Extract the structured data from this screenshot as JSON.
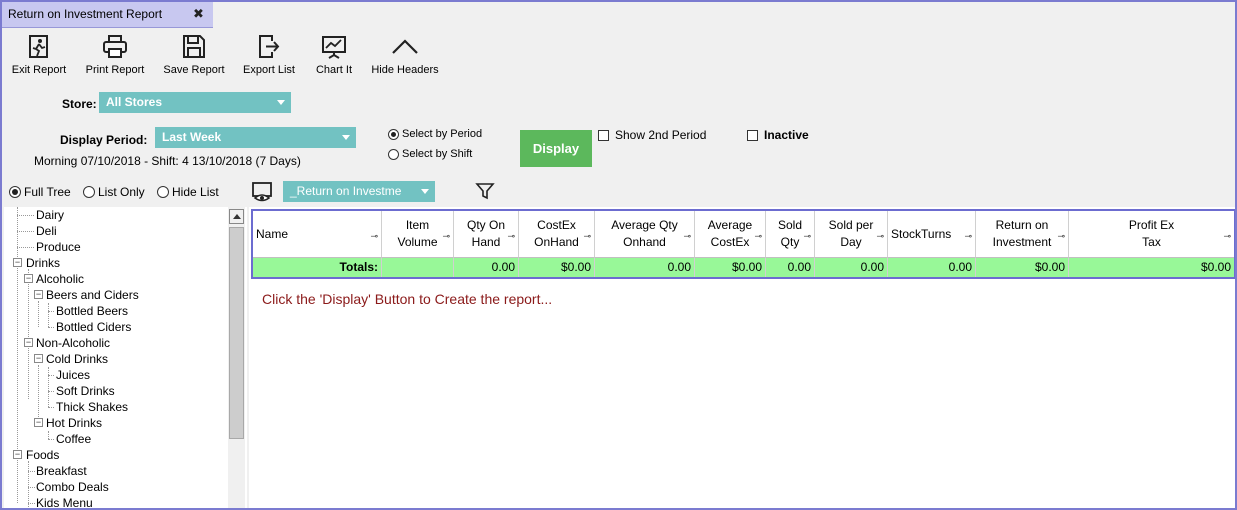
{
  "window": {
    "tab_title": "Return on Investment Report",
    "close_label": "✖"
  },
  "toolbar": {
    "exit": "Exit Report",
    "print": "Print Report",
    "save": "Save Report",
    "export": "Export List",
    "chart": "Chart It",
    "hide": "Hide Headers"
  },
  "filters": {
    "store_label": "Store:",
    "store_value": "All Stores",
    "period_label": "Display Period:",
    "period_value": "Last Week",
    "period_info": "Morning 07/10/2018 - Shift: 4 13/10/2018 (7 Days)",
    "select_by_period": "Select by Period",
    "select_by_shift": "Select by Shift",
    "display_button": "Display",
    "show_2nd_period": "Show 2nd Period",
    "inactive": "Inactive"
  },
  "tree_options": {
    "full_tree": "Full Tree",
    "list_only": "List Only",
    "hide_list": "Hide List"
  },
  "layout_combo": "_Return on Investme",
  "tree": [
    {
      "label": "Dairy"
    },
    {
      "label": "Deli"
    },
    {
      "label": "Produce"
    },
    {
      "label": "Drinks"
    },
    {
      "label": "Alcoholic"
    },
    {
      "label": "Beers and Ciders"
    },
    {
      "label": "Bottled Beers"
    },
    {
      "label": "Bottled Ciders"
    },
    {
      "label": "Non-Alcoholic"
    },
    {
      "label": "Cold Drinks"
    },
    {
      "label": "Juices"
    },
    {
      "label": "Soft Drinks"
    },
    {
      "label": "Thick Shakes"
    },
    {
      "label": "Hot Drinks"
    },
    {
      "label": "Coffee"
    },
    {
      "label": "Foods"
    },
    {
      "label": "Breakfast"
    },
    {
      "label": "Combo Deals"
    },
    {
      "label": "Kids Menu"
    }
  ],
  "grid": {
    "headers": [
      "Name",
      "Item Volume",
      "Qty On Hand",
      "CostEx OnHand",
      "Average Qty Onhand",
      "Average CostEx",
      "Sold Qty",
      "Sold per Day",
      "StockTurns",
      "Return on Investment",
      "Profit Ex Tax"
    ],
    "totals": [
      "Totals:",
      "",
      "0.00",
      "$0.00",
      "0.00",
      "$0.00",
      "0.00",
      "0.00",
      "0.00",
      "$0.00",
      "$0.00"
    ],
    "empty_prompt": "Click the 'Display' Button to Create the report..."
  }
}
